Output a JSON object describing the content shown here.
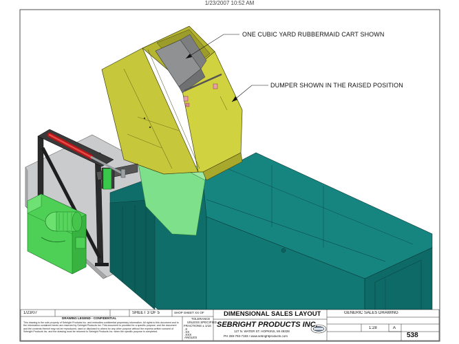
{
  "timestamp": "1/23/2007 10:52 AM",
  "callouts": {
    "cart": "ONE CUBIC YARD RUBBERMAID CART SHOWN",
    "dumper": "DUMPER SHOWN IN THE RAISED POSITION"
  },
  "title_block": {
    "date": "1/23/07",
    "sheet": "SHEET 3 OF 5",
    "shop_sheet": "SHOP SHEET XX OF",
    "legend_title": "DRAWING LEGEND - CONFIDENTIAL",
    "legal_text": "This drawing is the sole property of Sebright Products Inc. and embodies confidential proprietary information. All rights to this document and to the information contained herein are reserved by Sebright Products Inc. This document is provided for a specific purpose, and the document and the contents thereof may not be reproduced, used or disclosed to others for any other purpose without the express written consent of Sebright Products Inc. and the drawing must be returned to Sebright Products Inc. when the specific purpose is completed.",
    "tolerance_title": "TOLERANCE",
    "tolerance_sub": "UNLESS SPECIFIED",
    "fractions": "FRACTIONS ± 1/16",
    "tol_x": ".X",
    "tol_xx": ".XX",
    "tol_xxx": ".XXX",
    "angles": "ANGLES",
    "drawing_title": "DIMENSIONAL SALES LAYOUT",
    "company": "SEBRIGHT PRODUCTS INC.",
    "address": "127 N. WATER ST. HOPKINS, MI 49328",
    "phone": "PH 269-793-7183 / www.sebrightproducts.com",
    "customer": "GENERIC SALES DRAWING",
    "scale": "1:28",
    "rev": "A",
    "drawing_number": "538"
  }
}
